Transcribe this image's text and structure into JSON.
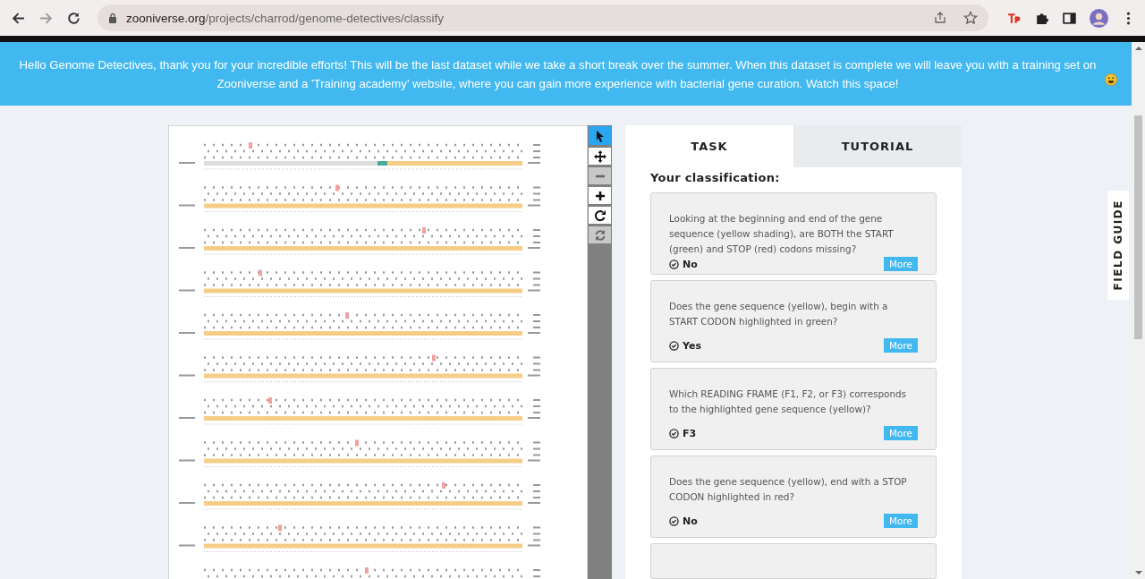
{
  "browser": {
    "url_domain": "zooniverse.org",
    "url_path": "/projects/charrod/genome-detectives/classify"
  },
  "banner": {
    "text": "Hello Genome Detectives, thank you for your incredible efforts! This will be the last dataset while we take a short break over the summer. When this dataset is complete we will leave you with a training set on Zooniverse and a 'Training academy' website, where you can gain more experience with bacterial gene curation. Watch this space!"
  },
  "tools": [
    {
      "kind": "pointer",
      "selected": true,
      "disabled": false
    },
    {
      "kind": "move",
      "selected": false,
      "disabled": false
    },
    {
      "kind": "zoom-out",
      "selected": false,
      "disabled": true
    },
    {
      "kind": "zoom-in",
      "selected": false,
      "disabled": false
    },
    {
      "kind": "rotate",
      "selected": false,
      "disabled": false
    },
    {
      "kind": "reset",
      "selected": false,
      "disabled": true
    }
  ],
  "tabs": [
    {
      "label": "TASK",
      "selected": true
    },
    {
      "label": "TUTORIAL",
      "selected": false
    }
  ],
  "classification": {
    "heading": "Your classification:",
    "answers": [
      {
        "question": "Looking at the beginning and end of the gene sequence (yellow shading), are BOTH the START (green) and STOP (red) codons missing?",
        "answer": "No",
        "button": "More"
      },
      {
        "question": "Does the gene sequence (yellow), begin with a START CODON highlighted in green?",
        "answer": "Yes",
        "button": "More"
      },
      {
        "question": "Which READING FRAME (F1, F2, or F3) corresponds to the highlighted gene sequence (yellow)?",
        "answer": "F3",
        "button": "More"
      },
      {
        "question": "Does the gene sequence (yellow), end with a STOP CODON highlighted in red?",
        "answer": "No",
        "button": "More"
      }
    ]
  },
  "field_guide": {
    "label": "FIELD GUIDE"
  }
}
